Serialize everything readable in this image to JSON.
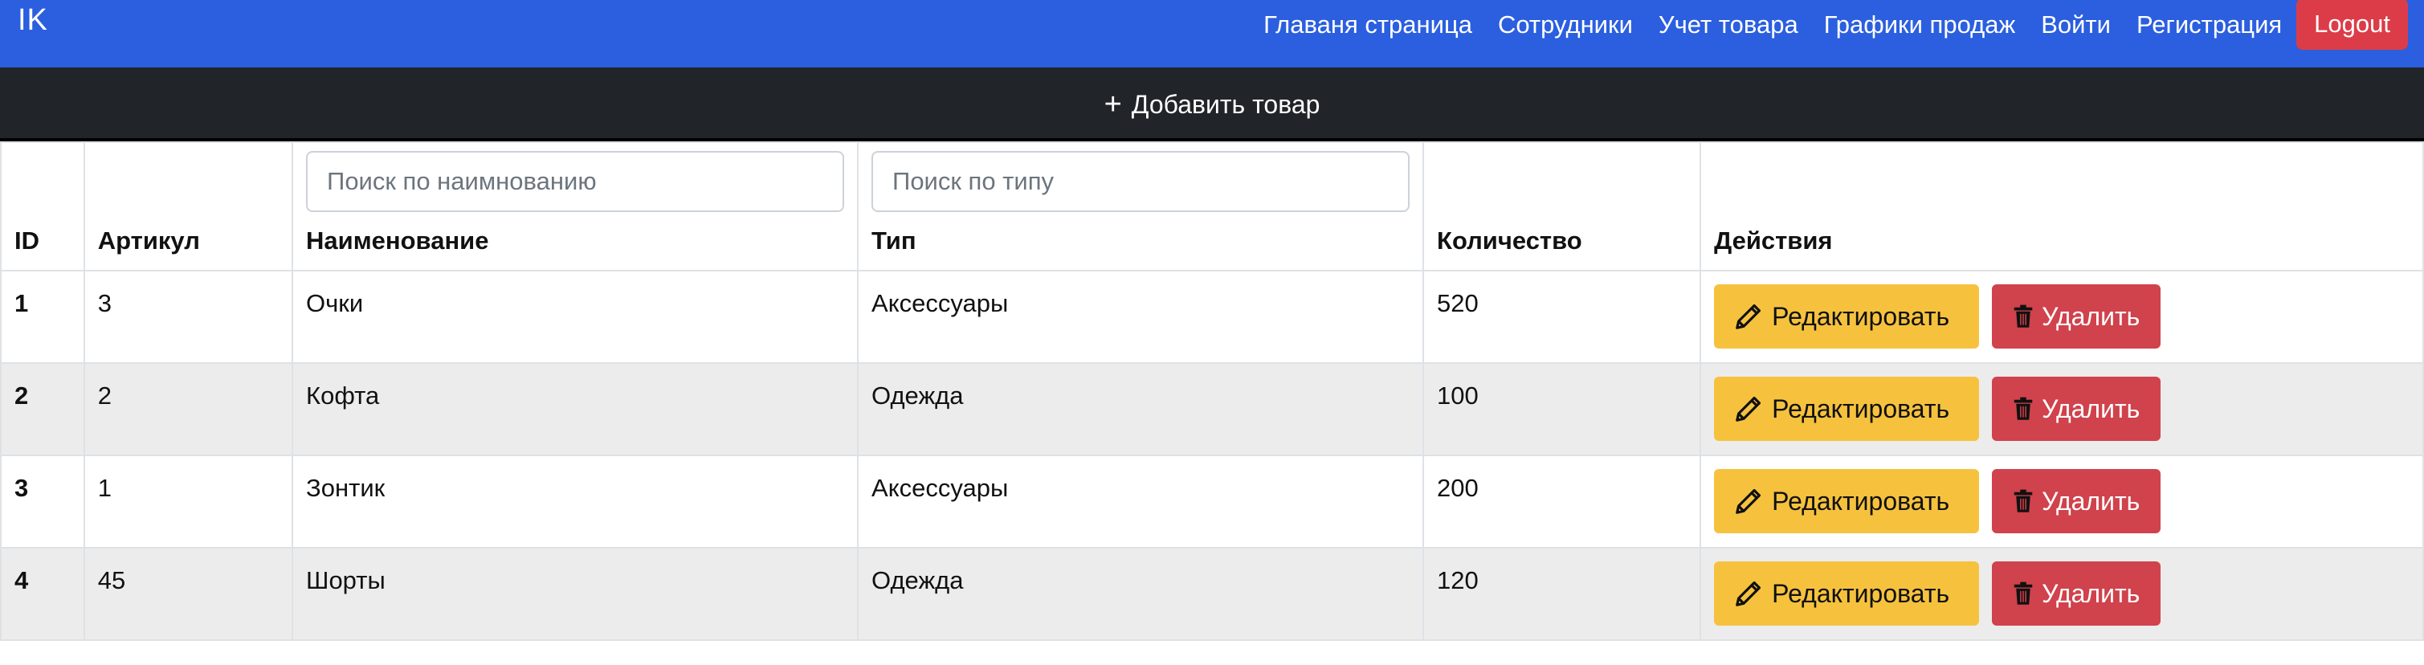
{
  "nav": {
    "brand": "IK",
    "links": [
      "Главаня страница",
      "Сотрудники",
      "Учет товара",
      "Графики продаж",
      "Войти",
      "Регистрация"
    ],
    "logout": "Logout"
  },
  "toolbar": {
    "add_label": "Добавить товар",
    "add_icon": "plus-icon"
  },
  "table": {
    "headers": {
      "id": "ID",
      "article": "Артикул",
      "name": "Наименование",
      "type": "Тип",
      "qty": "Количество",
      "actions": "Действия"
    },
    "search_name_placeholder": "Поиск по наимнованию",
    "search_type_placeholder": "Поиск по типу",
    "edit_label": "Редактировать",
    "delete_label": "Удалить",
    "rows": [
      {
        "id": "1",
        "article": "3",
        "name": "Очки",
        "type": "Аксессуары",
        "qty": "520"
      },
      {
        "id": "2",
        "article": "2",
        "name": "Кофта",
        "type": "Одежда",
        "qty": "100"
      },
      {
        "id": "3",
        "article": "1",
        "name": "Зонтик",
        "type": "Аксессуары",
        "qty": "200"
      },
      {
        "id": "4",
        "article": "45",
        "name": "Шорты",
        "type": "Одежда",
        "qty": "120"
      }
    ]
  },
  "colors": {
    "navbar": "#2b5fdf",
    "addbar": "#212529",
    "edit": "#f6c23e",
    "delete": "#d0424c",
    "logout": "#dc3c48"
  }
}
